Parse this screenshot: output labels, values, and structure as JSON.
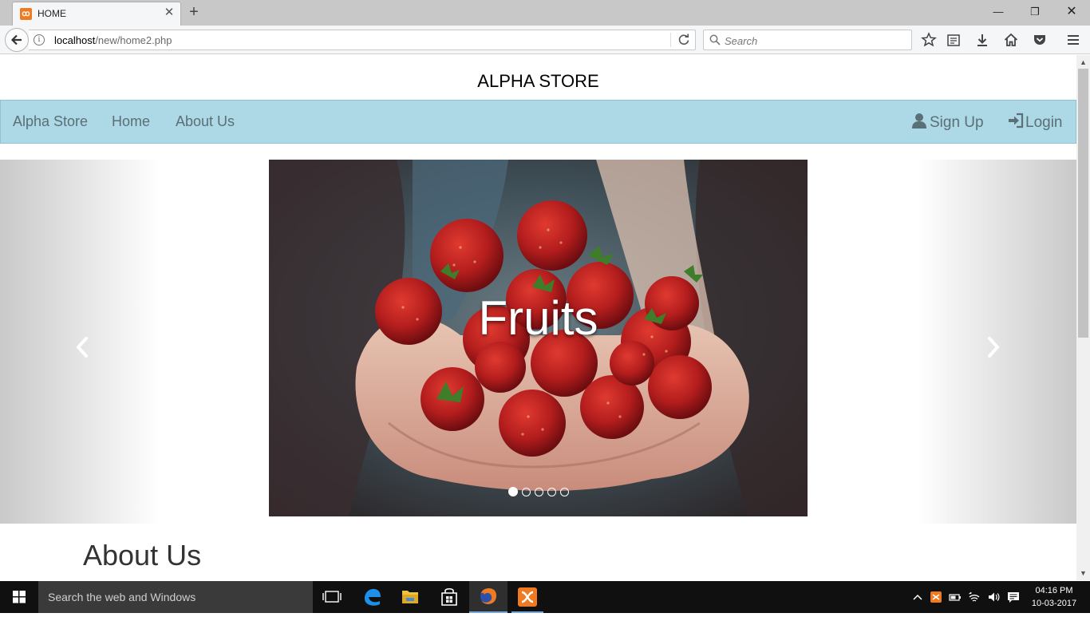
{
  "browser": {
    "tab_title": "HOME",
    "url_host": "localhost",
    "url_path": "/new/home2.php",
    "search_placeholder": "Search"
  },
  "site": {
    "title": "ALPHA STORE",
    "nav": {
      "brand": "Alpha Store",
      "home": "Home",
      "about": "About Us",
      "signup": "Sign Up",
      "login": "Login"
    },
    "carousel": {
      "caption": "Fruits",
      "slide_count": 5,
      "active_index": 0
    },
    "about_heading": "About Us"
  },
  "taskbar": {
    "search_text": "Search the web and Windows",
    "time": "04:16 PM",
    "date": "10-03-2017"
  },
  "colors": {
    "nav_bg": "#add8e6",
    "nav_text": "#5b6f76",
    "xampp_orange": "#f07a22",
    "taskbar_bg": "#101010"
  }
}
